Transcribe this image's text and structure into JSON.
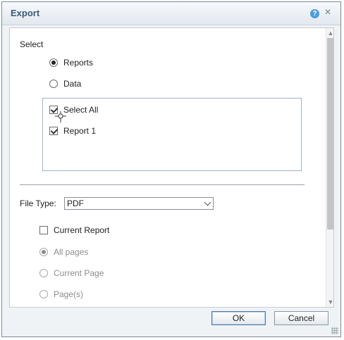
{
  "dialog": {
    "title": "Export",
    "help_icon": "help-icon",
    "close_icon": "close-icon"
  },
  "select_section": {
    "label": "Select",
    "options": [
      {
        "label": "Reports",
        "checked": true
      },
      {
        "label": "Data",
        "checked": false
      }
    ],
    "items": [
      {
        "label": "Select All",
        "checked": true
      },
      {
        "label": "Report 1",
        "checked": true
      }
    ]
  },
  "file_type": {
    "label": "File Type:",
    "value": "PDF"
  },
  "current_report": {
    "label": "Current Report",
    "checked": false
  },
  "pages": {
    "options": [
      {
        "label": "All pages",
        "checked": true
      },
      {
        "label": "Current Page",
        "checked": false
      },
      {
        "label": "Page(s)",
        "checked": false
      }
    ]
  },
  "buttons": {
    "ok": "OK",
    "cancel": "Cancel"
  }
}
